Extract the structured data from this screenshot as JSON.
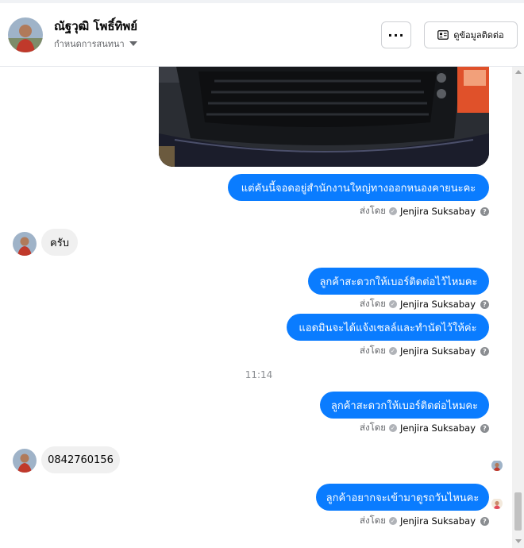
{
  "header": {
    "contact_name": "ณัฐวุฒิ โพธิ์ทิพย์",
    "subtitle": "กำหนดการสนทนา",
    "more_button_label": "···",
    "contact_info_button_label": "ดูข้อมูลติดต่อ"
  },
  "messages": {
    "m1_text": "แต่คันนี้จอดอยู่สำนักงานใหญ่ทางออกหนองคายนะคะ",
    "m2_text": "ครับ",
    "m3_text": "ลูกค้าสะดวกให้เบอร์ติดต่อไว้ไหมคะ",
    "m4_text": "แอดมินจะได้แจ้งเซลล์และทำนัดไว้ให้ค่ะ",
    "timestamp": "11:14",
    "m5_text": "ลูกค้าสะดวกให้เบอร์ติดต่อไหมคะ",
    "m6_text": "0842760156",
    "m7_text": "ลูกค้าอยากจะเข้ามาดูรถวันไหนคะ"
  },
  "sent_by": {
    "prefix": "ส่งโดย",
    "agent_name": "Jenjira Suksabay"
  },
  "colors": {
    "outgoing_bubble": "#0a7cff",
    "incoming_bubble": "#f0f0f0"
  },
  "icons": {
    "more": "ellipsis-icon",
    "contact_info": "contact-card-icon",
    "verified": "check-circle-icon",
    "info": "info-icon"
  }
}
